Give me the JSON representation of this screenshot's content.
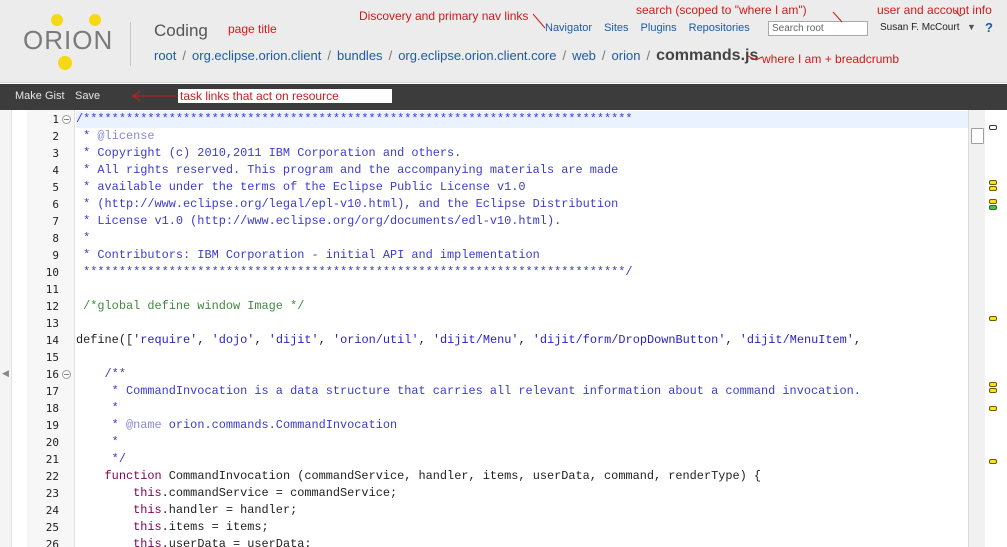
{
  "app": {
    "logo_text": "ORION",
    "page_title": "Coding"
  },
  "nav": {
    "links": [
      "Navigator",
      "Sites",
      "Plugins",
      "Repositories"
    ]
  },
  "search": {
    "placeholder": "Search root"
  },
  "user": {
    "name": "Susan F. McCourt",
    "help": "?"
  },
  "breadcrumb": {
    "crumbs": [
      "root",
      "org.eclipse.orion.client",
      "bundles",
      "org.eclipse.orion.client.core",
      "web",
      "orion"
    ],
    "separator": "/",
    "current": "commands.js"
  },
  "toolbar": {
    "make_gist": "Make Gist",
    "save": "Save"
  },
  "annotations": {
    "page_title": "page title",
    "nav": "Discovery and primary nav links",
    "search": "search (scoped to \"where I am\")",
    "user": "user and account info",
    "breadcrumb": "where I am + breadcrumb",
    "task": "task links that act on resource"
  },
  "editor": {
    "current_line": 1,
    "fold_lines": [
      1,
      16
    ],
    "lines": [
      {
        "n": 1,
        "text": "/*****************************************************************************"
      },
      {
        "n": 2,
        "text": " * @license"
      },
      {
        "n": 3,
        "text": " * Copyright (c) 2010,2011 IBM Corporation and others."
      },
      {
        "n": 4,
        "text": " * All rights reserved. This program and the accompanying materials are made"
      },
      {
        "n": 5,
        "text": " * available under the terms of the Eclipse Public License v1.0"
      },
      {
        "n": 6,
        "text": " * (http://www.eclipse.org/legal/epl-v10.html), and the Eclipse Distribution"
      },
      {
        "n": 7,
        "text": " * License v1.0 (http://www.eclipse.org/org/documents/edl-v10.html)."
      },
      {
        "n": 8,
        "text": " *"
      },
      {
        "n": 9,
        "text": " * Contributors: IBM Corporation - initial API and implementation"
      },
      {
        "n": 10,
        "text": " ****************************************************************************/"
      },
      {
        "n": 11,
        "text": ""
      },
      {
        "n": 12,
        "text": " /*global define window Image */"
      },
      {
        "n": 13,
        "text": ""
      },
      {
        "n": 14,
        "text": "define(['require', 'dojo', 'dijit', 'orion/util', 'dijit/Menu', 'dijit/form/DropDownButton', 'dijit/MenuItem',"
      },
      {
        "n": 15,
        "text": ""
      },
      {
        "n": 16,
        "text": "    /**"
      },
      {
        "n": 17,
        "text": "     * CommandInvocation is a data structure that carries all relevant information about a command invocation."
      },
      {
        "n": 18,
        "text": "     *"
      },
      {
        "n": 19,
        "text": "     * @name orion.commands.CommandInvocation"
      },
      {
        "n": 20,
        "text": "     *"
      },
      {
        "n": 21,
        "text": "     */"
      },
      {
        "n": 22,
        "text": "    function CommandInvocation (commandService, handler, items, userData, command, renderType) {"
      },
      {
        "n": 23,
        "text": "        this.commandService = commandService;"
      },
      {
        "n": 24,
        "text": "        this.handler = handler;"
      },
      {
        "n": 25,
        "text": "        this.items = items;"
      },
      {
        "n": 26,
        "text": "        this.userData = userData;"
      }
    ]
  },
  "overview_ruler": {
    "markers": [
      "warning",
      "warning",
      "warning",
      "warning",
      "info",
      "warning",
      "warning",
      "warning",
      "warning",
      "warning"
    ]
  },
  "colors": {
    "header_bg": "#ececec",
    "toolbar_bg": "#3c3c3c",
    "link": "#1f5aa5",
    "annotation": "#d11a1a",
    "comment": "#3c3ccc",
    "string": "#2a22c2",
    "keyword": "#7f0055",
    "logo_yellow": "#f5d916"
  }
}
